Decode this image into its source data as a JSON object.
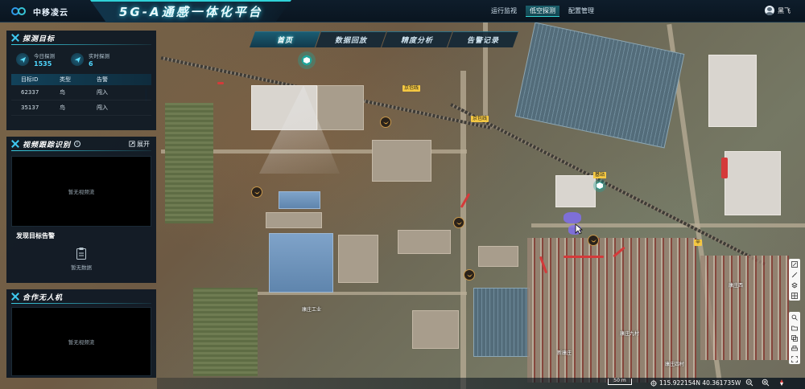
{
  "header": {
    "logo_text": "中移凌云",
    "platform_title": "5G-A通感一体化平台",
    "nav": [
      {
        "label": "运行监视",
        "active": false
      },
      {
        "label": "低空探测",
        "active": true
      },
      {
        "label": "配置管理",
        "active": false
      }
    ],
    "user_name": "黑飞"
  },
  "map_tabs": [
    {
      "label": "首页",
      "active": true
    },
    {
      "label": "数据回放",
      "active": false
    },
    {
      "label": "精度分析",
      "active": false
    },
    {
      "label": "告警记录",
      "active": false
    }
  ],
  "detect_panel": {
    "title": "探测目标",
    "today_label": "今日探测",
    "today_value": "1535",
    "realtime_label": "实时探测",
    "realtime_value": "6",
    "columns": [
      "目标ID",
      "类型",
      "告警"
    ],
    "rows": [
      [
        "62337",
        "鸟",
        "闯入"
      ],
      [
        "35137",
        "鸟",
        "闯入"
      ]
    ]
  },
  "video_panel": {
    "title": "视频跟踪识别",
    "expand_label": "展开",
    "no_video": "暂无视频流"
  },
  "alarm_panel": {
    "title": "发现目标告警",
    "no_data": "暂无数据"
  },
  "uav_panel": {
    "title": "合作无人机",
    "no_video": "暂无视频流"
  },
  "status_bar": {
    "scale": "50 m",
    "coordinates": "115.922154N 40.361735W"
  },
  "colors": {
    "accent": "#3ec8f0",
    "value": "#4fd7ff",
    "track": "#d43a3a",
    "poi_border": "#c7974b"
  }
}
